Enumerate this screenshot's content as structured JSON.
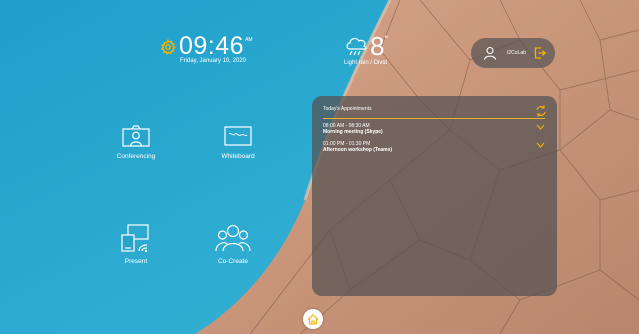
{
  "clock": {
    "time": "09:46",
    "ampm": "AM",
    "date": "Friday, January 10, 2020"
  },
  "weather": {
    "temperature": "8",
    "degree": "°",
    "description": "Light rain / Divst",
    "icon": "cloud-rain-icon"
  },
  "user": {
    "name": "I2CoLab",
    "icon": "user-icon",
    "exit_icon": "exit-icon"
  },
  "apps": [
    {
      "label": "Conferencing",
      "icon": "camera-icon"
    },
    {
      "label": "Whiteboard",
      "icon": "whiteboard-icon"
    },
    {
      "label": "Present",
      "icon": "screen-cast-icon"
    },
    {
      "label": "Co-Create",
      "icon": "group-icon"
    }
  ],
  "appointments": {
    "title": "Today's Appointments",
    "items": [
      {
        "time": "08:00 AM - 08:30 AM",
        "title": "Morning meeting (Skype)"
      },
      {
        "time": "01:00 PM - 01:30 PM",
        "title": "Afternoon workshop (Teams)"
      }
    ]
  },
  "colors": {
    "accent": "#f0b400",
    "sky": "#2aa3c9",
    "panel": "#555254"
  }
}
